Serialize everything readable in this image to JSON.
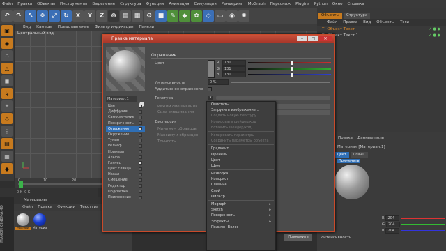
{
  "menubar": [
    "Файл",
    "Правка",
    "Объекты",
    "Инструменты",
    "Выделение",
    "Структура",
    "Функции",
    "Анимация",
    "Симуляция",
    "Рендеринг",
    "MoGraph",
    "Персонаж",
    "Plugins",
    "Python",
    "Окно",
    "Справка"
  ],
  "toolbar": {
    "icons": [
      "undo-icon",
      "redo-icon",
      "select-icon",
      "move-icon",
      "scale-icon",
      "rotate-icon",
      "axis-x",
      "axis-y",
      "axis-z",
      "world-icon",
      "render-icon",
      "render-view-icon",
      "render-settings-icon",
      "cube-icon",
      "pen-icon",
      "subdivide-icon",
      "array-icon",
      "deformer-icon",
      "floor-icon",
      "camera-icon",
      "light-icon"
    ],
    "axis": [
      "X",
      "Y",
      "Z"
    ]
  },
  "viewport": {
    "menu": [
      "Вид",
      "Камеры",
      "Представление",
      "Фильтр индикации",
      "Панели"
    ],
    "label": "Центральный вид"
  },
  "timeline": {
    "ticks": [
      "0",
      "10",
      "20"
    ],
    "frame": "0 K",
    "frame2": "0 K"
  },
  "materials": {
    "title": "Материалы",
    "menu": [
      "Файл",
      "Правка",
      "Функции",
      "Текстура"
    ],
    "items": [
      {
        "name": "Матери",
        "color": "#d0d0d0"
      },
      {
        "name": "Материа",
        "color": "#1a3fd0"
      }
    ]
  },
  "maxon": "MAXON CINEMA 4D",
  "objects": {
    "tabs": [
      "Объекты",
      "Структура"
    ],
    "menu": [
      "Файл",
      "Правка",
      "Вид",
      "Объекты",
      "Тэги"
    ],
    "rows": [
      {
        "name": "Объект Текст",
        "color": "#e08a2a"
      },
      {
        "name": "Объект Текст.1",
        "color": "#c8c8c8"
      }
    ]
  },
  "attributes": {
    "menu": [
      "Правка",
      "Данные поль"
    ],
    "title": "Материал [Материал.1]",
    "tabs": [
      "Цвет",
      "Глянц."
    ],
    "note": "Применить",
    "sub": "Интенсивность",
    "fields": [
      "204",
      "204",
      "204"
    ]
  },
  "dialog": {
    "title": "Правка материала",
    "material_name": "Материал.1",
    "channels": [
      {
        "name": "Цвет",
        "checked": true
      },
      {
        "name": "Диффузия",
        "checked": false
      },
      {
        "name": "Самосвечение",
        "checked": false
      },
      {
        "name": "Прозрачность",
        "checked": false
      },
      {
        "name": "Отражение",
        "checked": true,
        "selected": true
      },
      {
        "name": "Окружение",
        "checked": false
      },
      {
        "name": "Туман",
        "checked": false
      },
      {
        "name": "Рельеф",
        "checked": false
      },
      {
        "name": "Нормали",
        "checked": false
      },
      {
        "name": "Альфа",
        "checked": false
      },
      {
        "name": "Глянец",
        "checked": true
      },
      {
        "name": "Цвет глянца",
        "checked": false
      },
      {
        "name": "Накал",
        "checked": false
      },
      {
        "name": "Смещение",
        "checked": false
      },
      {
        "name": "Редактор",
        "checked": false
      },
      {
        "name": "Подсветка",
        "checked": false
      },
      {
        "name": "Применение",
        "checked": false
      }
    ],
    "section": "Отражение",
    "color_label": "Цвет",
    "rgb": [
      {
        "ch": "R",
        "val": "131"
      },
      {
        "ch": "G",
        "val": "131"
      },
      {
        "ch": "B",
        "val": "131"
      }
    ],
    "intensity_label": "Интенсивность",
    "intensity_val": "0 %",
    "additive_label": "Аддитивное отражение",
    "texture_label": "Текстура",
    "mix_mode_label": "Режим смешивания",
    "mix_strength_label": "Сила смешивания",
    "dispersion_label": "Дисперсия",
    "min_samples_label": "Минимум образцов",
    "max_samples_label": "Максимум образцов",
    "accuracy_label": "Точность",
    "ok_label": "Применить"
  },
  "context_menu": {
    "items": [
      {
        "label": "Очистить",
        "state": "normal"
      },
      {
        "label": "Загрузить изображение...",
        "state": "normal"
      },
      {
        "label": "Создать новую текстуру...",
        "state": "disabled"
      },
      {
        "label": "Копировать шейдер/код",
        "state": "disabled"
      },
      {
        "label": "Вставить шейдер/код",
        "state": "disabled"
      },
      {
        "sep": true
      },
      {
        "label": "Копировать параметры",
        "state": "disabled"
      },
      {
        "label": "Сохранить параметры объекта",
        "state": "disabled"
      },
      {
        "sep": true
      },
      {
        "label": "Градиент",
        "state": "normal"
      },
      {
        "label": "Френель",
        "state": "normal"
      },
      {
        "label": "Цвет",
        "state": "normal"
      },
      {
        "label": "Шум",
        "state": "normal"
      },
      {
        "sep": true
      },
      {
        "label": "Разводка",
        "state": "normal"
      },
      {
        "label": "Колорист",
        "state": "normal"
      },
      {
        "label": "Слияние",
        "state": "normal"
      },
      {
        "label": "Слой",
        "state": "normal"
      },
      {
        "label": "Фильтр",
        "state": "normal"
      },
      {
        "sep": true
      },
      {
        "label": "Mograph",
        "state": "normal",
        "sub": true
      },
      {
        "label": "Sketch",
        "state": "normal",
        "sub": true
      },
      {
        "label": "Поверхность",
        "state": "normal",
        "sub": true
      },
      {
        "label": "Эффекты",
        "state": "normal",
        "sub": true
      },
      {
        "label": "Полигон Волос",
        "state": "normal"
      }
    ]
  }
}
